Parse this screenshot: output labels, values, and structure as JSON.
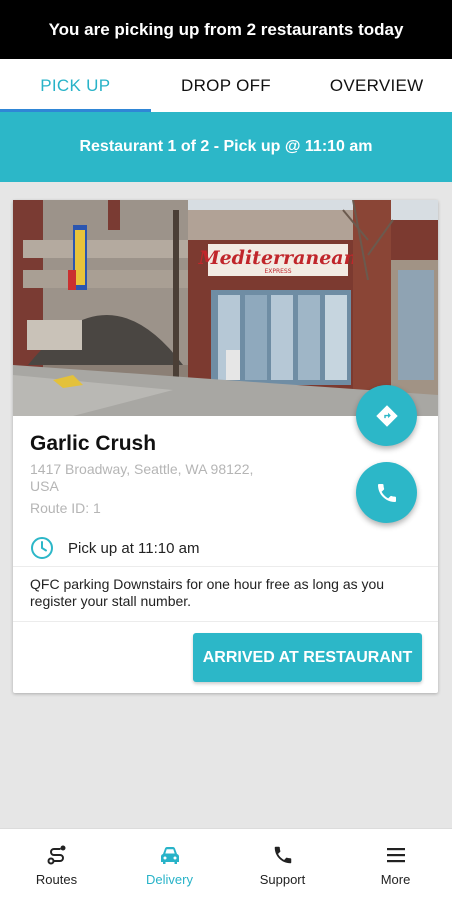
{
  "banner": {
    "text": "You are picking up from 2 restaurants today"
  },
  "tabs": [
    {
      "label": "PICK UP",
      "active": true
    },
    {
      "label": "DROP OFF",
      "active": false
    },
    {
      "label": "OVERVIEW",
      "active": false
    }
  ],
  "subheader": {
    "text": "Restaurant 1 of 2 - Pick up @ 11:10 am"
  },
  "restaurant": {
    "photo_sign": "Mediterranean",
    "photo_sign_sub": "EXPRESS",
    "name": "Garlic Crush",
    "address_line1": "1417 Broadway, Seattle, WA 98122,",
    "address_line2": "USA",
    "route": "Route ID: 1",
    "pickup_time": "Pick up at 11:10 am",
    "note": "QFC parking Downstairs for one hour free as long as you register your stall number.",
    "arrived_label": "ARRIVED AT RESTAURANT"
  },
  "nav": [
    {
      "label": "Routes",
      "icon": "route-icon",
      "active": false
    },
    {
      "label": "Delivery",
      "icon": "car-icon",
      "active": true
    },
    {
      "label": "Support",
      "icon": "phone-icon",
      "active": false
    },
    {
      "label": "More",
      "icon": "menu-icon",
      "active": false
    }
  ],
  "colors": {
    "accent": "#2cb7c8",
    "tab_indicator": "#2f86d6",
    "banner": "#000000"
  }
}
